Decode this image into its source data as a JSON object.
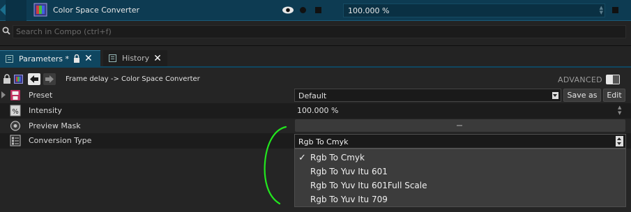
{
  "effect": {
    "name": "Color Space Converter",
    "value": "100.000 %",
    "icons": [
      "fx-icon",
      "eye-icon",
      "dot-icon",
      "square-icon"
    ]
  },
  "search": {
    "placeholder": "Search in Compo (ctrl+f)"
  },
  "tabs": [
    {
      "label": "Parameters *",
      "active": true
    },
    {
      "label": "History",
      "active": false
    }
  ],
  "toolbar": {
    "path": "Frame delay -> Color Space Converter",
    "advanced_label": "ADVANCED"
  },
  "params": {
    "preset": {
      "label": "Preset",
      "value": "Default",
      "save_label": "Save as",
      "edit_label": "Edit"
    },
    "intensity": {
      "label": "Intensity",
      "value": "100.000 %"
    },
    "preview_mask": {
      "label": "Preview Mask"
    },
    "conversion": {
      "label": "Conversion Type",
      "value": "Rgb To Cmyk"
    }
  },
  "dropdown": {
    "items": [
      {
        "label": "Rgb To Cmyk",
        "checked": true,
        "check": "✓"
      },
      {
        "label": "Rgb To Yuv Itu 601",
        "checked": false
      },
      {
        "label": "Rgb To Yuv Itu 601Full Scale",
        "checked": false
      },
      {
        "label": "Rgb To Yuv Itu 709",
        "checked": false
      }
    ]
  },
  "colors": {
    "accent": "#0f4660",
    "background": "#232323",
    "annotation": "#22e61e"
  }
}
